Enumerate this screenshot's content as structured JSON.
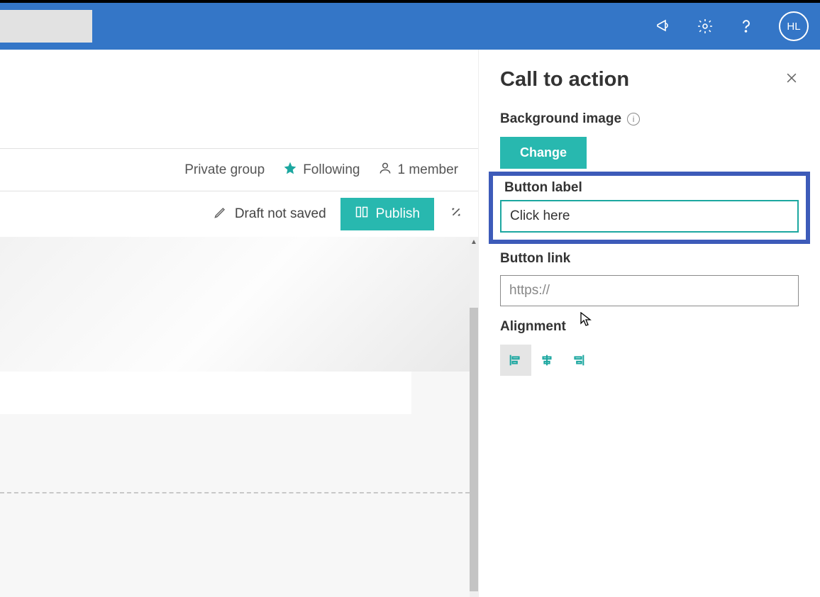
{
  "suite": {
    "avatar_initials": "HL"
  },
  "site": {
    "privacy": "Private group",
    "following": "Following",
    "members": "1 member"
  },
  "command": {
    "draft_status": "Draft not saved",
    "publish": "Publish"
  },
  "panel": {
    "title": "Call to action",
    "background_image_label": "Background image",
    "change_button": "Change",
    "button_label_label": "Button label",
    "button_label_value": "Click here",
    "button_link_label": "Button link",
    "button_link_placeholder": "https://",
    "alignment_label": "Alignment"
  }
}
